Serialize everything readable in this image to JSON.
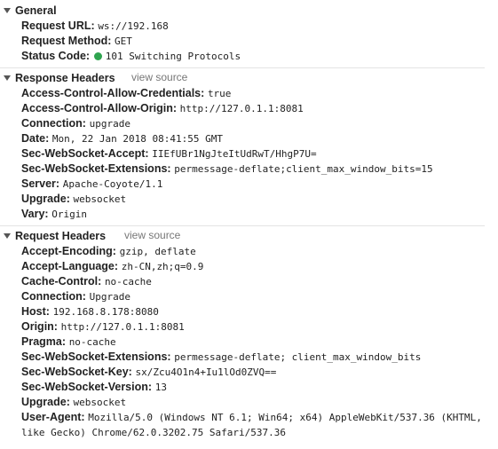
{
  "general": {
    "title": "General",
    "rows": [
      {
        "key": "Request URL:",
        "value": "ws://192.168"
      },
      {
        "key": "Request Method:",
        "value": "GET"
      },
      {
        "key": "Status Code:",
        "value": "101 Switching Protocols"
      }
    ],
    "status_color": "#2fa44f"
  },
  "response_headers": {
    "title": "Response Headers",
    "view_source": "view source",
    "rows": [
      {
        "key": "Access-Control-Allow-Credentials:",
        "value": "true"
      },
      {
        "key": "Access-Control-Allow-Origin:",
        "value": "http://127.0.1.1:8081"
      },
      {
        "key": "Connection:",
        "value": "upgrade"
      },
      {
        "key": "Date:",
        "value": "Mon, 22 Jan 2018 08:41:55 GMT"
      },
      {
        "key": "Sec-WebSocket-Accept:",
        "value": "IIEfUBr1NgJteItUdRwT/HhgP7U="
      },
      {
        "key": "Sec-WebSocket-Extensions:",
        "value": "permessage-deflate;client_max_window_bits=15"
      },
      {
        "key": "Server:",
        "value": "Apache-Coyote/1.1"
      },
      {
        "key": "Upgrade:",
        "value": "websocket"
      },
      {
        "key": "Vary:",
        "value": "Origin"
      }
    ]
  },
  "request_headers": {
    "title": "Request Headers",
    "view_source": "view source",
    "rows": [
      {
        "key": "Accept-Encoding:",
        "value": "gzip, deflate"
      },
      {
        "key": "Accept-Language:",
        "value": "zh-CN,zh;q=0.9"
      },
      {
        "key": "Cache-Control:",
        "value": "no-cache"
      },
      {
        "key": "Connection:",
        "value": "Upgrade"
      },
      {
        "key": "Host:",
        "value": "192.168.8.178:8080"
      },
      {
        "key": "Origin:",
        "value": "http://127.0.1.1:8081"
      },
      {
        "key": "Pragma:",
        "value": "no-cache"
      },
      {
        "key": "Sec-WebSocket-Extensions:",
        "value": "permessage-deflate; client_max_window_bits"
      },
      {
        "key": "Sec-WebSocket-Key:",
        "value": "sx/Zcu4O1n4+Iu1lOd0ZVQ=="
      },
      {
        "key": "Sec-WebSocket-Version:",
        "value": "13"
      },
      {
        "key": "Upgrade:",
        "value": "websocket"
      },
      {
        "key": "User-Agent:",
        "value": "Mozilla/5.0 (Windows NT 6.1; Win64; x64) AppleWebKit/537.36 (KHTML,"
      }
    ],
    "user_agent_continuation": "like Gecko) Chrome/62.0.3202.75 Safari/537.36"
  }
}
